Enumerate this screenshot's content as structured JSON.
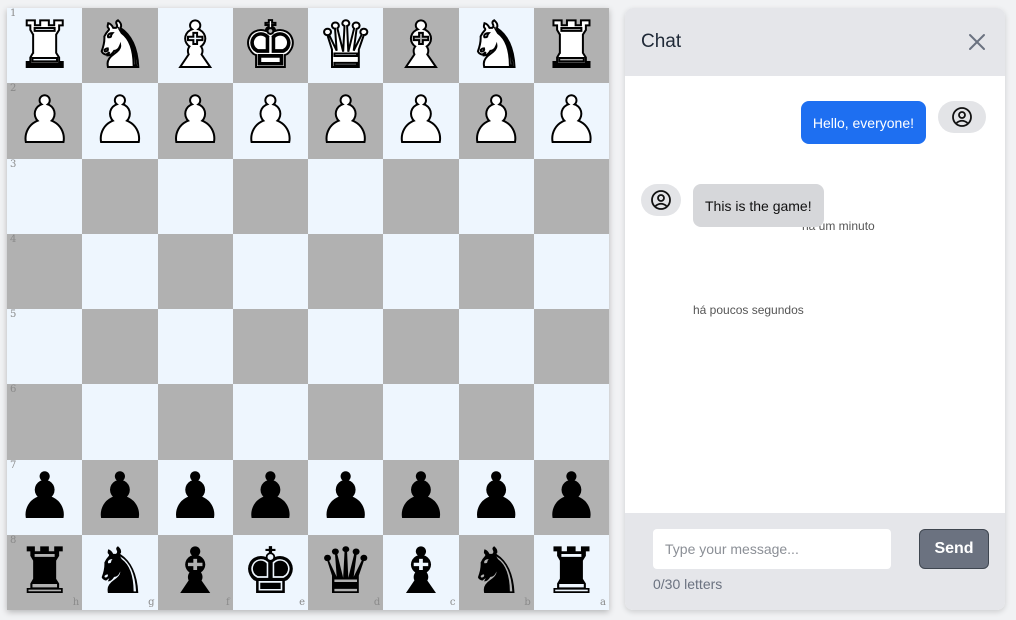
{
  "board": {
    "ranks": [
      "1",
      "2",
      "3",
      "4",
      "5",
      "6",
      "7",
      "8"
    ],
    "files": [
      "h",
      "g",
      "f",
      "e",
      "d",
      "c",
      "b",
      "a"
    ],
    "rows": [
      [
        "♜",
        "♞",
        "♝",
        "♚",
        "♛",
        "♝",
        "♞",
        "♜"
      ],
      [
        "♟",
        "♟",
        "♟",
        "♟",
        "♟",
        "♟",
        "♟",
        "♟"
      ],
      [
        "",
        "",
        "",
        "",
        "",
        "",
        "",
        ""
      ],
      [
        "",
        "",
        "",
        "",
        "",
        "",
        "",
        ""
      ],
      [
        "",
        "",
        "",
        "",
        "",
        "",
        "",
        ""
      ],
      [
        "",
        "",
        "",
        "",
        "",
        "",
        "",
        ""
      ],
      [
        "♟",
        "♟",
        "♟",
        "♟",
        "♟",
        "♟",
        "♟",
        "♟"
      ],
      [
        "♜",
        "♞",
        "♝",
        "♚",
        "♛",
        "♝",
        "♞",
        "♜"
      ]
    ],
    "colors": [
      "white",
      "white",
      "",
      "",
      "",
      "",
      "black",
      "black"
    ],
    "light_color": "#eef6fe",
    "dark_color": "#b1b1b1"
  },
  "chat": {
    "title": "Chat",
    "close_icon": "close-icon",
    "messages": [
      {
        "text": "Hello, everyone!",
        "time": "há um minuto",
        "direction": "outgoing",
        "bubble_color": "#1e6ff1"
      },
      {
        "text": "This is the game!",
        "time": "há poucos segundos",
        "direction": "incoming",
        "bubble_color": "#d6d7da"
      }
    ],
    "input": {
      "placeholder": "Type your message...",
      "value": ""
    },
    "send_label": "Send",
    "counter": "0/30 letters"
  }
}
